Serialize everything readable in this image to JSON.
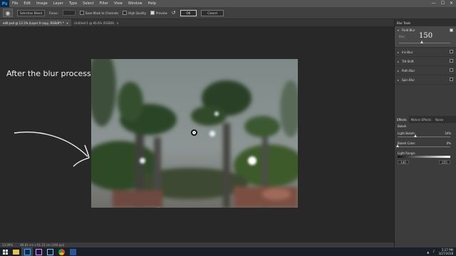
{
  "app": {
    "logo": "Ps"
  },
  "menu": [
    "File",
    "Edit",
    "Image",
    "Layer",
    "Type",
    "Select",
    "Filter",
    "View",
    "Window",
    "Help"
  ],
  "window_controls": [
    "—",
    "☐",
    "✕"
  ],
  "options_bar": {
    "tool_icon": "blur-tools-icon",
    "selection_mode": "Selection Bleed",
    "focus_label": "Focus:",
    "save_mask": "Save Mask to Channels",
    "high_quality": "High Quality",
    "preview": "Preview",
    "ok": "OK",
    "cancel": "Cancel"
  },
  "tabs": [
    {
      "label": "edit.psd @ 13.1% (Layer 0 copy, RGB/8*) *",
      "close": "×"
    },
    {
      "label": "Untitled-1 @ 66.6% (RGB/8)",
      "close": "×"
    }
  ],
  "canvas": {
    "annotation": "After the blur process"
  },
  "status": {
    "zoom": "13.09%",
    "doc": "88.83 cm x 61.23 cm (240 ppi)"
  },
  "blur_panel": {
    "title": "Blur Tools",
    "items": [
      {
        "label": "Field Blur",
        "expanded": true,
        "checked": true
      },
      {
        "label": "Iris Blur",
        "expanded": false,
        "checked": false
      },
      {
        "label": "Tilt-Shift",
        "expanded": false,
        "checked": false
      },
      {
        "label": "Path Blur",
        "expanded": false,
        "checked": false
      },
      {
        "label": "Spin Blur",
        "expanded": false,
        "checked": false
      }
    ],
    "field_blur": {
      "sub_label": "Blur:",
      "value": "150",
      "level": 0.45
    }
  },
  "effects": {
    "tabs": [
      "Effects",
      "Motion Effects",
      "Noise"
    ],
    "bokeh_label": "Bokeh",
    "light_bokeh": {
      "label": "Light Bokeh:",
      "value": "34%",
      "level": 0.34
    },
    "bokeh_color": {
      "label": "Bokeh Color:",
      "value": "0%",
      "level": 0.0
    },
    "light_range": {
      "label": "Light Range:",
      "low": "140",
      "high": "255"
    }
  },
  "taskbar": {
    "apps": [
      "explorer-icon",
      "photoshop-icon",
      "premiere-icon",
      "lightroom-icon",
      "chrome-icon",
      "word-icon"
    ],
    "time": "5:27 PM",
    "date": "3/27/2018"
  }
}
